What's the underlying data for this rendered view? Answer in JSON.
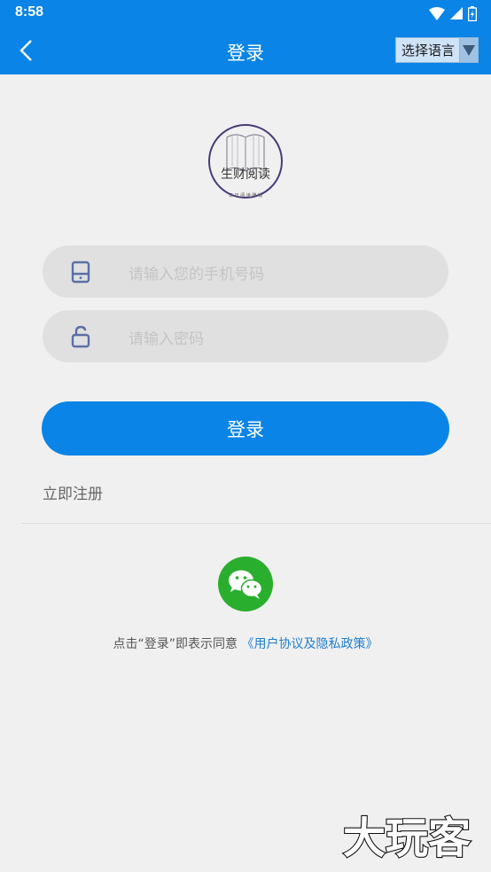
{
  "status_bar": {
    "time": "8:58"
  },
  "app_bar": {
    "title": "登录",
    "language_button": "选择语言"
  },
  "logo": {
    "name": "生财阅读",
    "tagline": "日 日 阅 读 赚 钱"
  },
  "form": {
    "phone_placeholder": "请输入您的手机号码",
    "password_placeholder": "请输入密码",
    "login_button": "登录",
    "register_link": "立即注册"
  },
  "agreement": {
    "prefix": "点击“登录”即表示同意 ",
    "link": "《用户协议及隐私政策》"
  },
  "watermark": "大玩客",
  "colors": {
    "primary": "#0a84e6",
    "wechat": "#2aae2e",
    "input_bg": "#e0e0e0"
  },
  "icons": [
    "back-icon",
    "dropdown-triangle-icon",
    "phone-icon",
    "unlock-icon",
    "wechat-icon",
    "wifi-icon",
    "signal-icon",
    "battery-icon"
  ]
}
